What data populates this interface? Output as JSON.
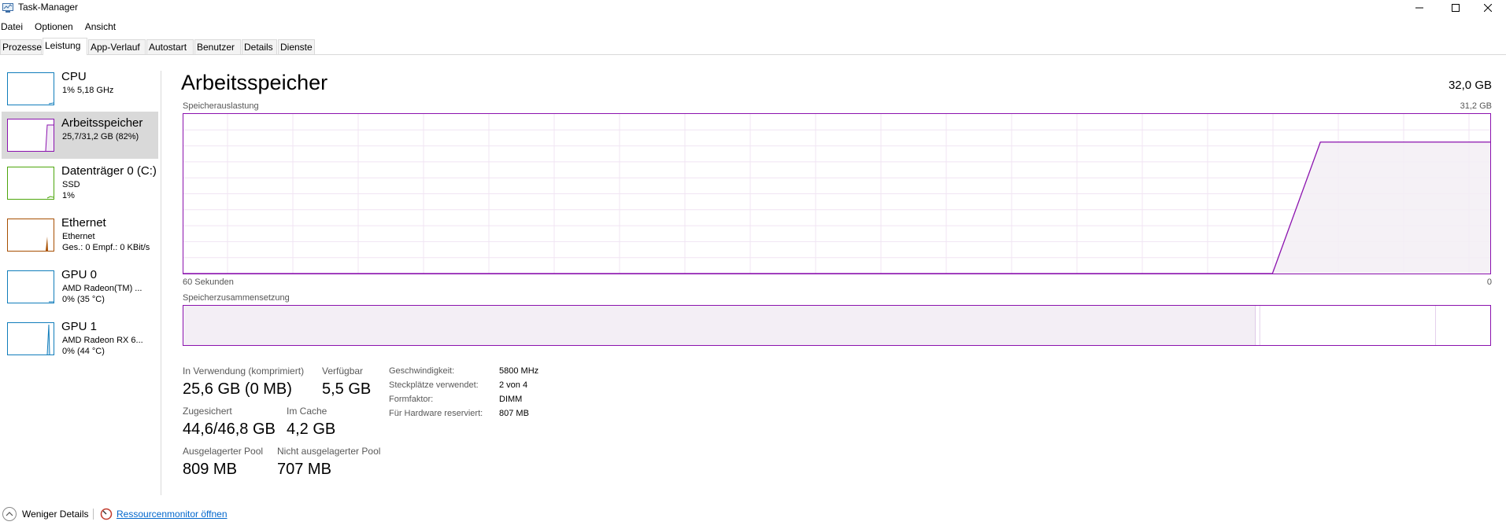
{
  "window": {
    "title": "Task-Manager"
  },
  "menu": [
    "Datei",
    "Optionen",
    "Ansicht"
  ],
  "tabs": [
    "Prozesse",
    "Leistung",
    "App-Verlauf",
    "Autostart",
    "Benutzer",
    "Details",
    "Dienste"
  ],
  "active_tab": "Leistung",
  "sidebar": {
    "items": [
      {
        "title": "CPU",
        "line1": "1%  5,18 GHz",
        "line2": "",
        "color": "#117dbb",
        "utilization_percent": 1
      },
      {
        "title": "Arbeitsspeicher",
        "line1": "25,7/31,2 GB (82%)",
        "line2": "",
        "color": "#8b12ae",
        "utilization_percent": 82
      },
      {
        "title": "Datenträger 0 (C:)",
        "line1": "SSD",
        "line2": "1%",
        "color": "#4da60c",
        "utilization_percent": 1
      },
      {
        "title": "Ethernet",
        "line1": "Ethernet",
        "line2": "Ges.: 0  Empf.: 0 KBit/s",
        "color": "#a74f01",
        "utilization_percent": 0
      },
      {
        "title": "GPU 0",
        "line1": "AMD Radeon(TM) ...",
        "line2": "0%  (35 °C)",
        "color": "#117dbb",
        "utilization_percent": 0
      },
      {
        "title": "GPU 1",
        "line1": "AMD Radeon RX 6...",
        "line2": "0%  (44 °C)",
        "color": "#117dbb",
        "utilization_percent": 0
      }
    ],
    "selected": "Arbeitsspeicher"
  },
  "main": {
    "title": "Arbeitsspeicher",
    "total": "32,0 GB",
    "usage_label": "Speicherauslastung",
    "usage_max": "31,2 GB",
    "time_label": "60 Sekunden",
    "time_end": "0",
    "composition_label": "Speicherzusammensetzung"
  },
  "stats": {
    "in_use_label": "In Verwendung (komprimiert)",
    "in_use_value": "25,6 GB (0 MB)",
    "available_label": "Verfügbar",
    "available_value": "5,5 GB",
    "committed_label": "Zugesichert",
    "committed_value": "44,6/46,8 GB",
    "cached_label": "Im Cache",
    "cached_value": "4,2 GB",
    "paged_label": "Ausgelagerter Pool",
    "paged_value": "809 MB",
    "nonpaged_label": "Nicht ausgelagerter Pool",
    "nonpaged_value": "707 MB"
  },
  "details": [
    {
      "label": "Geschwindigkeit:",
      "value": "5800 MHz"
    },
    {
      "label": "Steckplätze verwendet:",
      "value": "2 von 4"
    },
    {
      "label": "Formfaktor:",
      "value": "DIMM"
    },
    {
      "label": "Für Hardware reserviert:",
      "value": "807 MB"
    }
  ],
  "footer": {
    "less_details": "Weniger Details",
    "resmon_link": "Ressourcenmonitor öffnen"
  },
  "chart_data": {
    "type": "area",
    "title": "Speicherauslastung",
    "xlabel": "60 Sekunden",
    "ylabel": "",
    "xlim": [
      60,
      0
    ],
    "ylim": [
      0,
      31.2
    ],
    "grid": true,
    "series": [
      {
        "x": [
          60,
          10,
          7.8,
          5,
          2.5,
          0
        ],
        "values": [
          0,
          0,
          25.7,
          25.7,
          25.7,
          25.7
        ]
      }
    ],
    "composition": {
      "in_use_gb": 25.6,
      "modified_gb": 0.1,
      "standby_gb": 4.2,
      "free_gb": 1.3
    }
  }
}
